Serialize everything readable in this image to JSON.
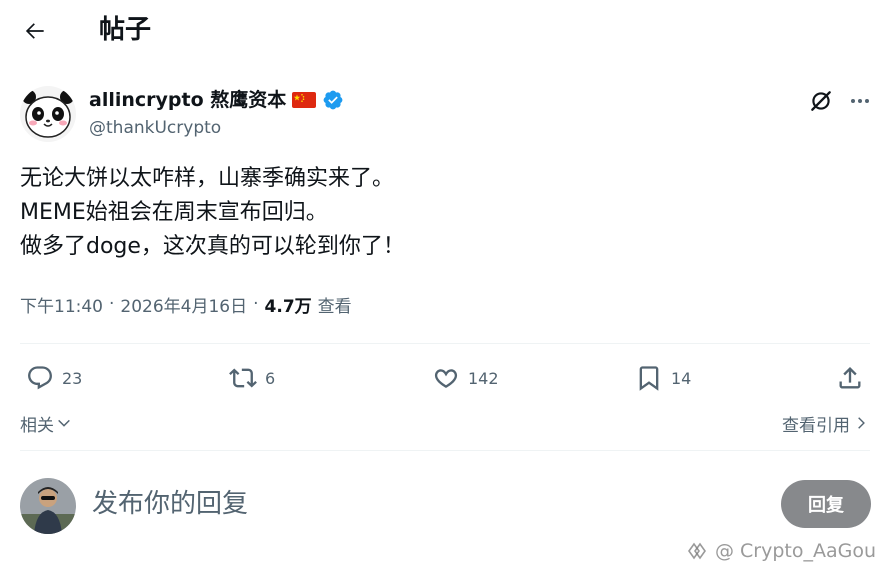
{
  "header": {
    "title": "帖子"
  },
  "author": {
    "name": "allincrypto 熬鹰资本",
    "handle": "@thankUcrypto"
  },
  "tweet": {
    "lines": [
      "无论大饼以太咋样，山寨季确实来了。",
      "MEME始祖会在周末宣布回归。",
      "做多了doge，这次真的可以轮到你了！"
    ]
  },
  "meta": {
    "time": "下午11:40",
    "date": "2026年4月16日",
    "views_count": "4.7万",
    "views_label": "查看"
  },
  "actions": {
    "replies": "23",
    "retweets": "6",
    "likes": "142",
    "bookmarks": "14"
  },
  "links": {
    "related": "相关",
    "view_quotes": "查看引用"
  },
  "reply": {
    "placeholder": "发布你的回复",
    "button": "回复"
  },
  "watermark": "@ Crypto_AaGou",
  "colors": {
    "verified": "#1d9bf0",
    "secondary_text": "#536471",
    "reply_button": "#87898c",
    "flag_red": "#de2910",
    "flag_yellow": "#ffde00"
  },
  "icons": {
    "back": "arrow-left-icon",
    "verified": "verified-badge-icon",
    "grok": "grok-icon",
    "more": "more-icon",
    "reply": "reply-icon",
    "retweet": "retweet-icon",
    "like": "heart-icon",
    "bookmark": "bookmark-icon",
    "share": "share-icon"
  }
}
